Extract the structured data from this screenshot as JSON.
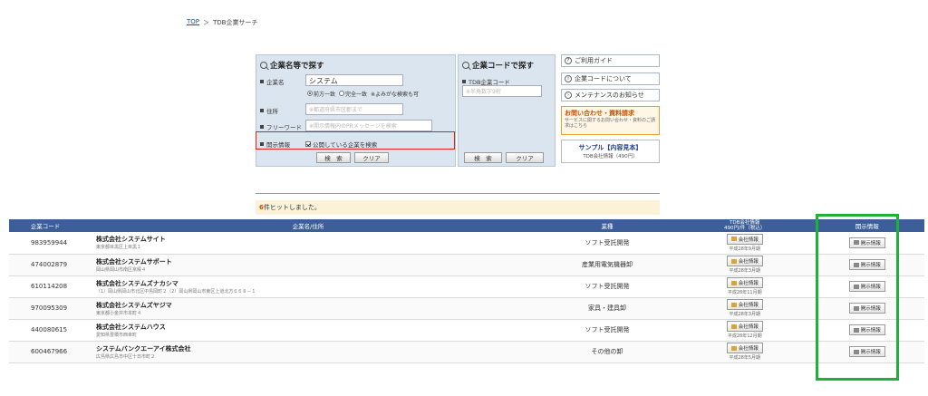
{
  "breadcrumb": {
    "home": "TOP",
    "sep": "＞",
    "current": "TDB企業サーチ"
  },
  "search_name": {
    "title": "企業名等で探す",
    "company_label": "企業名",
    "company_value": "システム",
    "match_options": [
      "前方一致",
      "完全一致",
      "※よみがな検索も可"
    ],
    "address_label": "住所",
    "address_placeholder": "※都道府県市区郡まで",
    "freeword_label": "フリーワード",
    "freeword_placeholder": "※開示情報内のPRメッセージを検索",
    "disclosure_label": "開示情報",
    "disclosure_checkbox": "公開している企業を検索",
    "search_button": "検　索",
    "clear_button": "クリア"
  },
  "search_code": {
    "title": "企業コードで探す",
    "code_label": "TDB企業コード",
    "code_placeholder": "※半角数字9桁",
    "search_button": "検　索",
    "clear_button": "クリア"
  },
  "side": {
    "guide": "ご利用ガイド",
    "code_about": "企業コードについて",
    "maintenance": "メンテナンスのお知らせ",
    "inquiry_title": "お問い合わせ・資料請求",
    "inquiry_sub": "サービスに関するお問い合わせ・資料のご請求はこちら",
    "sample_title": "サンプル【内容見本】",
    "sample_sub": "TDB会社情報（490円）"
  },
  "hits": {
    "count": "6",
    "text": "件ヒットしました。"
  },
  "table": {
    "headers": {
      "code": "企業コード",
      "name": "企業名/住所",
      "industry": "業種",
      "info_line1": "TDB会社情報",
      "info_line2": "490円/件（税込）",
      "disclosure": "開示情報"
    },
    "info_button": "会社情報",
    "disclosure_button": "開示情報",
    "rows": [
      {
        "code": "983959944",
        "name": "株式会社システムサイト",
        "address": "東京都目黒区上目黒１",
        "industry": "ソフト受託開発",
        "date": "平成28年9月期"
      },
      {
        "code": "474002879",
        "name": "株式会社システムサポート",
        "address": "岡山県岡山市南区京殿４",
        "industry": "産業用電気機器卸",
        "date": "平成28年3月期"
      },
      {
        "code": "610114208",
        "name": "株式会社システムズナカシマ",
        "address": "（1）岡山県岡山市北区中島岡町２（2）岡山県岡山市東区上道北方６６８－１",
        "industry": "ソフト受託開発",
        "date": "平成28年11月期"
      },
      {
        "code": "970095309",
        "name": "株式会社システムズヤジマ",
        "address": "東京都小金井市本町４",
        "industry": "家具・建具卸",
        "date": "平成28年3月期"
      },
      {
        "code": "440080615",
        "name": "株式会社システムハウス",
        "address": "愛知県豊橋市西幸町",
        "industry": "ソフト受託開発",
        "date": "平成28年12月期"
      },
      {
        "code": "600467966",
        "name": "システムバンクエーアイ株式会社",
        "address": "広島県広島市中区十日市町２",
        "industry": "その他の卸",
        "date": "平成28年5月期"
      }
    ]
  },
  "colors": {
    "header_bg": "#3c5f9a",
    "panel_bg": "#dbe5ef",
    "highlight_red": "#e02020",
    "highlight_green": "#1fb03a"
  }
}
